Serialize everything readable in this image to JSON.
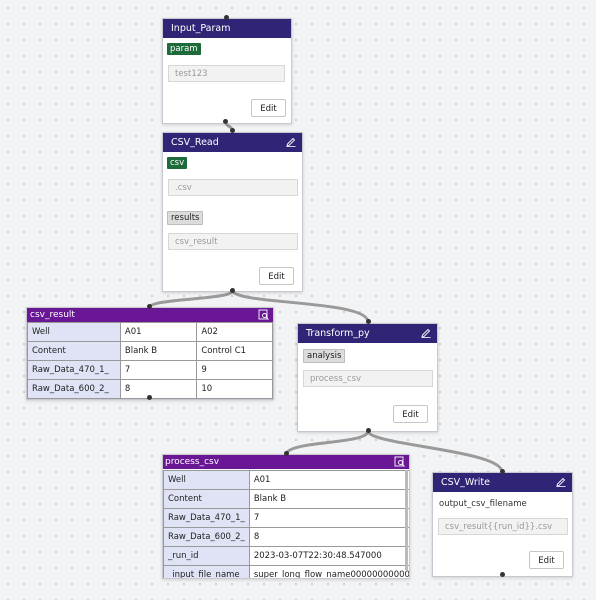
{
  "nodes": {
    "input_param": {
      "title": "Input_Param",
      "tag": "param",
      "value": "test123",
      "edit_label": "Edit"
    },
    "csv_read": {
      "title": "CSV_Read",
      "tag": "csv",
      "placeholder": ".csv",
      "output_tag": "results",
      "output_value": "csv_result",
      "edit_label": "Edit"
    },
    "csv_result": {
      "title": "csv_result",
      "rows": [
        {
          "key": "Well",
          "values": [
            "A01",
            "A02"
          ]
        },
        {
          "key": "Content",
          "values": [
            "Blank B",
            "Control C1"
          ]
        },
        {
          "key": "Raw_Data_470_1_",
          "values": [
            "7",
            "9"
          ]
        },
        {
          "key": "Raw_Data_600_2_",
          "values": [
            "8",
            "10"
          ]
        }
      ]
    },
    "transform_py": {
      "title": "Transform_py",
      "tag": "analysis",
      "value": "process_csv",
      "edit_label": "Edit"
    },
    "process_csv": {
      "title": "process_csv",
      "rows": [
        {
          "key": "Well",
          "value": "A01"
        },
        {
          "key": "Content",
          "value": "Blank B"
        },
        {
          "key": "Raw_Data_470_1_",
          "value": "7"
        },
        {
          "key": "Raw_Data_600_2_",
          "value": "8"
        },
        {
          "key": "_run_id",
          "value": "2023-03-07T22:30:48.547000"
        },
        {
          "key": "_input_file_name",
          "value": "super_long_flow_name00000000000"
        }
      ]
    },
    "csv_write": {
      "title": "CSV_Write",
      "label": "output_csv_filename",
      "placeholder": "csv_result{{run_id}}.csv",
      "edit_label": "Edit"
    }
  },
  "colors": {
    "header_navy": "#2f2577",
    "header_purple": "#6a1796",
    "tag_green": "#1d6b3a",
    "key_cell": "#dfe3f5"
  }
}
